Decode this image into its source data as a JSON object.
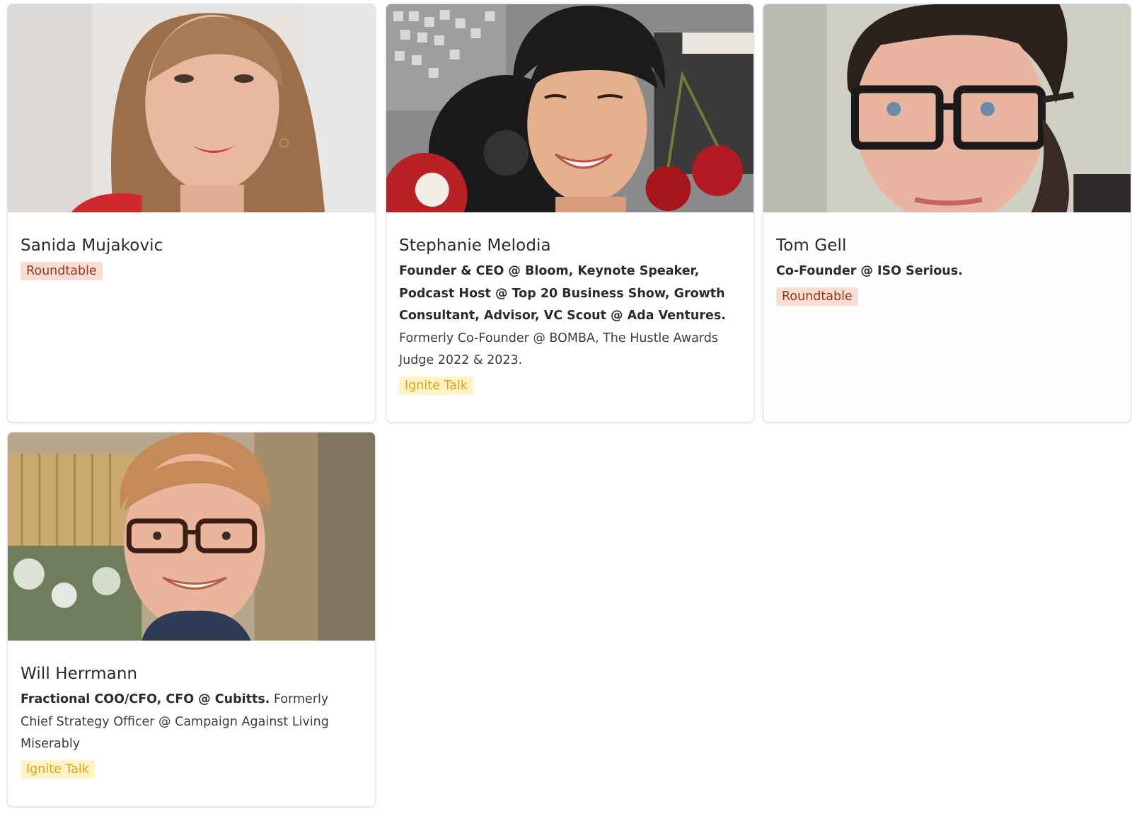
{
  "speakers": [
    {
      "name": "Sanida Mujakovic",
      "bio_strong": "",
      "bio": "",
      "tag": "Roundtable"
    },
    {
      "name": "Stephanie Melodia",
      "bio_strong": "Founder & CEO @ Bloom, Keynote Speaker, Podcast Host @ Top 20 Business Show, Growth Consultant, Advisor, VC Scout @ Ada Ventures.",
      "bio": " Formerly Co-Founder @ BOMBA, The Hustle Awards Judge 2022 & 2023.",
      "tag": "Ignite Talk"
    },
    {
      "name": "Tom Gell",
      "bio_strong": "Co-Founder @ ISO Serious.",
      "bio": "",
      "tag": "Roundtable"
    },
    {
      "name": "Will Herrmann",
      "bio_strong": "Fractional COO/CFO, CFO @ Cubitts.",
      "bio": " Formerly Chief Strategy Officer @ Campaign Against Living Miserably",
      "tag": "Ignite Talk"
    }
  ],
  "colors": {
    "roundtable_bg": "#fbdcd2",
    "roundtable_text": "#8b3a26",
    "ignite_bg": "#fdf3c4",
    "ignite_text": "#d9a41c",
    "card_border": "#e3e3e6"
  }
}
